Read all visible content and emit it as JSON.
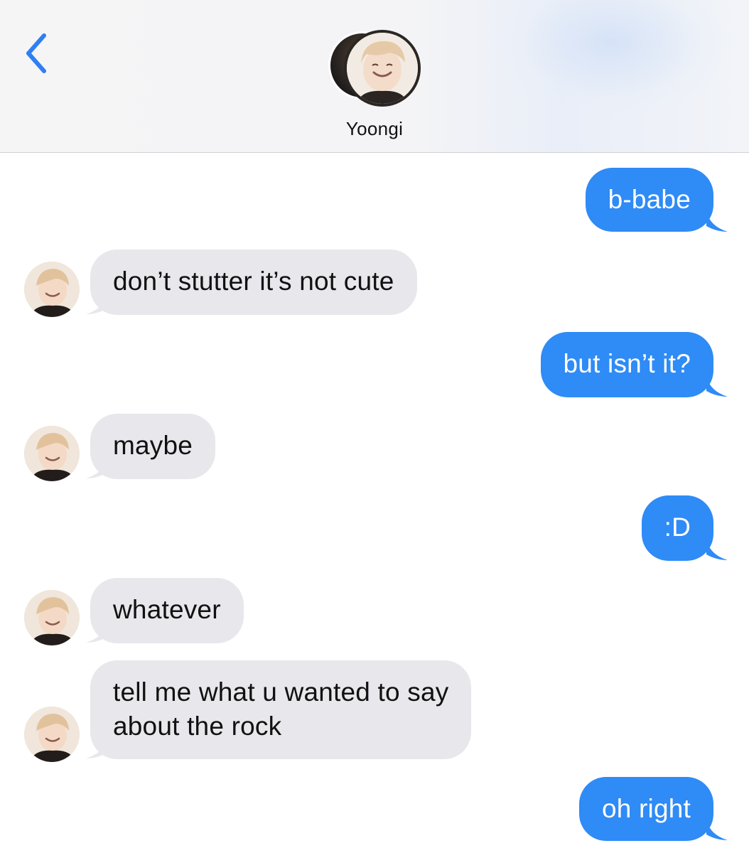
{
  "header": {
    "contact_name": "Yoongi",
    "back_icon": "chevron-left-icon",
    "accent_color": "#2f8bf5"
  },
  "messages": [
    {
      "direction": "sent",
      "text": "b-babe"
    },
    {
      "direction": "received",
      "text": "don’t stutter it’s not cute"
    },
    {
      "direction": "sent",
      "text": "but isn’t it?"
    },
    {
      "direction": "received",
      "text": "maybe"
    },
    {
      "direction": "sent",
      "text": ":D"
    },
    {
      "direction": "received",
      "text": "whatever"
    },
    {
      "direction": "received",
      "lines": [
        "tell me what u wanted to say",
        "about the rock"
      ]
    },
    {
      "direction": "sent",
      "text": "oh right"
    }
  ],
  "colors": {
    "sent_bubble": "#2f8bf5",
    "received_bubble": "#e7e7ec"
  }
}
